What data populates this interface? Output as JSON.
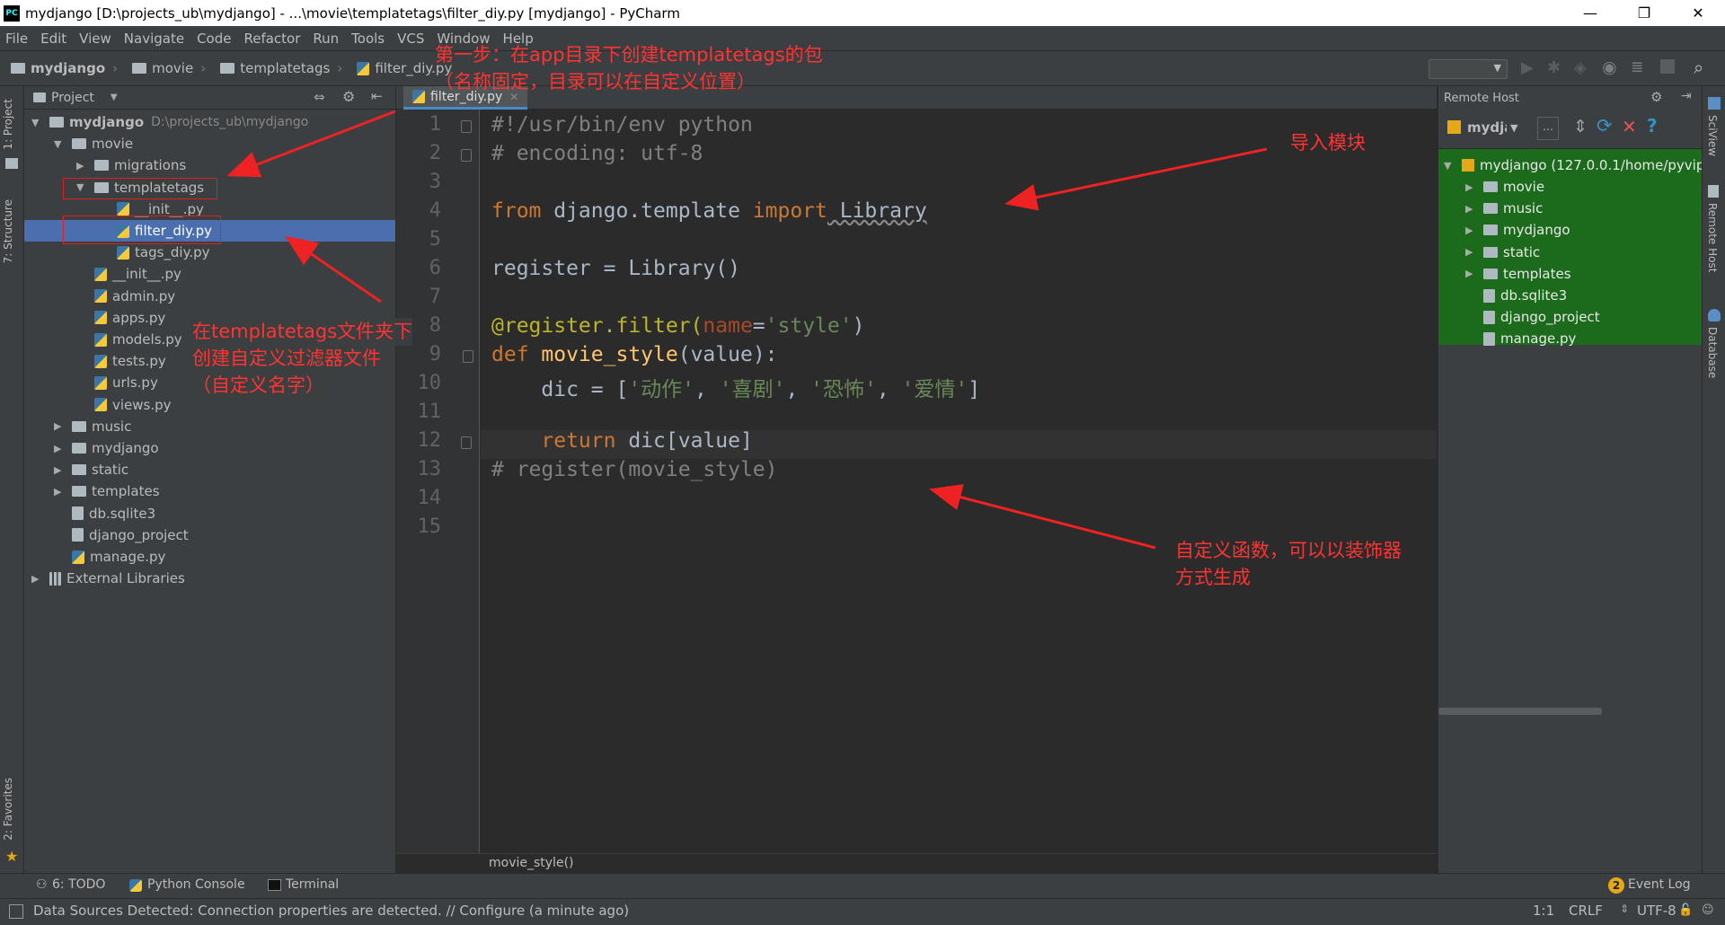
{
  "window": {
    "title": "mydjango [D:\\projects_ub\\mydjango] - ...\\movie\\templatetags\\filter_diy.py [mydjango] - PyCharm",
    "minimize": "—",
    "restore": "❐",
    "close": "✕"
  },
  "menu": [
    "File",
    "Edit",
    "View",
    "Navigate",
    "Code",
    "Refactor",
    "Run",
    "Tools",
    "VCS",
    "Window",
    "Help"
  ],
  "breadcrumbs": [
    "mydjango",
    "movie",
    "templatetags",
    "filter_diy.py"
  ],
  "project_panel": {
    "title": "Project",
    "tree": [
      {
        "label": "mydjango",
        "extra": "D:\\projects_ub\\mydjango",
        "kind": "folder",
        "depth": 0,
        "open": true,
        "bold": true
      },
      {
        "label": "movie",
        "kind": "folder",
        "depth": 1,
        "open": true
      },
      {
        "label": "migrations",
        "kind": "folder",
        "depth": 2,
        "open": false
      },
      {
        "label": "templatetags",
        "kind": "folder",
        "depth": 2,
        "open": true
      },
      {
        "label": "__init__.py",
        "kind": "py",
        "depth": 3
      },
      {
        "label": "filter_diy.py",
        "kind": "py",
        "depth": 3,
        "selected": true
      },
      {
        "label": "tags_diy.py",
        "kind": "py",
        "depth": 3
      },
      {
        "label": "__init__.py",
        "kind": "py",
        "depth": 2
      },
      {
        "label": "admin.py",
        "kind": "py",
        "depth": 2
      },
      {
        "label": "apps.py",
        "kind": "py",
        "depth": 2
      },
      {
        "label": "models.py",
        "kind": "py",
        "depth": 2
      },
      {
        "label": "tests.py",
        "kind": "py",
        "depth": 2
      },
      {
        "label": "urls.py",
        "kind": "py",
        "depth": 2
      },
      {
        "label": "views.py",
        "kind": "py",
        "depth": 2
      },
      {
        "label": "music",
        "kind": "folder",
        "depth": 1,
        "open": false
      },
      {
        "label": "mydjango",
        "kind": "folder",
        "depth": 1,
        "open": false
      },
      {
        "label": "static",
        "kind": "folder",
        "depth": 1,
        "open": false
      },
      {
        "label": "templates",
        "kind": "folder",
        "depth": 1,
        "open": false
      },
      {
        "label": "db.sqlite3",
        "kind": "file",
        "depth": 1
      },
      {
        "label": "django_project",
        "kind": "file",
        "depth": 1
      },
      {
        "label": "manage.py",
        "kind": "py",
        "depth": 1
      },
      {
        "label": "External Libraries",
        "kind": "lib",
        "depth": 0,
        "open": false
      }
    ]
  },
  "editor": {
    "tab": "filter_diy.py",
    "line_numbers": [
      "1",
      "2",
      "3",
      "4",
      "5",
      "6",
      "7",
      "8",
      "9",
      "10",
      "11",
      "12",
      "13",
      "14",
      "15"
    ],
    "lines": [
      [
        {
          "t": "#!/usr/bin/env python",
          "c": "cm"
        }
      ],
      [
        {
          "t": "# encoding: utf-8",
          "c": "cm"
        }
      ],
      [],
      [
        {
          "t": "from",
          "c": "kw"
        },
        {
          "t": " django.template ",
          "c": ""
        },
        {
          "t": "import",
          "c": "kw"
        },
        {
          "t": " Library",
          "c": ""
        }
      ],
      [],
      [
        {
          "t": "register = Library()",
          "c": ""
        }
      ],
      [],
      [
        {
          "t": "@register.filter(",
          "c": "dec"
        },
        {
          "t": "name",
          "c": "pm"
        },
        {
          "t": "=",
          "c": ""
        },
        {
          "t": "'style'",
          "c": "st"
        },
        {
          "t": ")",
          "c": ""
        }
      ],
      [
        {
          "t": "def",
          "c": "kw"
        },
        {
          "t": " ",
          "c": ""
        },
        {
          "t": "movie_style",
          "c": "fn"
        },
        {
          "t": "(value):",
          "c": ""
        }
      ],
      [
        {
          "t": "    dic = [",
          "c": ""
        },
        {
          "t": "'动作'",
          "c": "st"
        },
        {
          "t": ", ",
          "c": ""
        },
        {
          "t": "'喜剧'",
          "c": "st"
        },
        {
          "t": ", ",
          "c": ""
        },
        {
          "t": "'恐怖'",
          "c": "st"
        },
        {
          "t": ", ",
          "c": ""
        },
        {
          "t": "'爱情'",
          "c": "st"
        },
        {
          "t": "]",
          "c": ""
        }
      ],
      [],
      [
        {
          "t": "    return",
          "c": "kw"
        },
        {
          "t": " dic[value]",
          "c": ""
        }
      ],
      [
        {
          "t": "# register(movie_style)",
          "c": "cm"
        }
      ],
      [],
      []
    ],
    "breadcrumb": "movie_style()"
  },
  "remote_host": {
    "title": "Remote Host",
    "server": "mydjango",
    "root": "mydjango (127.0.0.1/home/pyvip",
    "items": [
      {
        "label": "movie",
        "kind": "folder"
      },
      {
        "label": "music",
        "kind": "folder"
      },
      {
        "label": "mydjango",
        "kind": "folder"
      },
      {
        "label": "static",
        "kind": "folder"
      },
      {
        "label": "templates",
        "kind": "folder"
      },
      {
        "label": "db.sqlite3",
        "kind": "file"
      },
      {
        "label": "django_project",
        "kind": "file"
      },
      {
        "label": "manage.py",
        "kind": "file"
      }
    ]
  },
  "side_tabs": {
    "left": [
      "1: Project",
      "7: Structure",
      "2: Favorites"
    ],
    "right": [
      "SciView",
      "Remote Host",
      "Database"
    ]
  },
  "bottom_tools": [
    "6: TODO",
    "Python Console",
    "Terminal"
  ],
  "event_log": {
    "count": "2",
    "label": "Event Log"
  },
  "status": {
    "message": "Data Sources Detected: Connection properties are detected. // Configure (a minute ago)",
    "position": "1:1",
    "line_sep": "CRLF",
    "encoding": "UTF-8"
  },
  "annotations": {
    "step1_line1": "第一步：在app目录下创建templatetags的包",
    "step1_line2": "（名称固定，目录可以在自定义位置）",
    "import_note": "导入模块",
    "filter_line1": "在templatetags文件夹下",
    "filter_line2": "创建自定义过滤器文件",
    "filter_line3": "（自定义名字）",
    "func_line1": "自定义函数，可以以装饰器",
    "func_line2": "方式生成"
  },
  "colors": {
    "accent": "#4b6eaf",
    "annotation": "#ff3333",
    "remote_bg": "#1c6b1c"
  }
}
